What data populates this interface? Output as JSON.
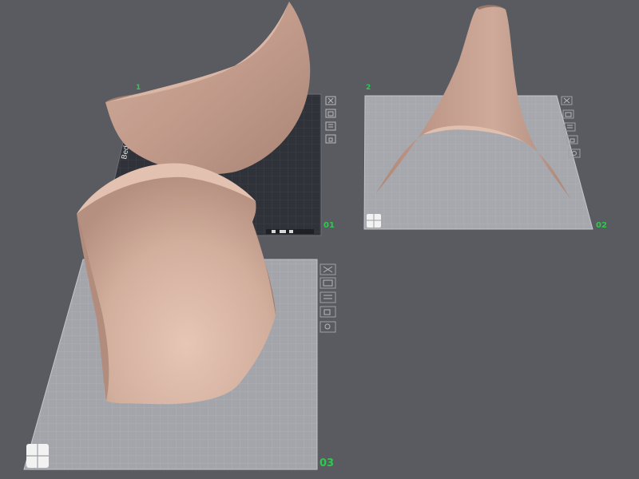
{
  "plates": [
    {
      "number": "01",
      "marker": "1",
      "vertical_label": "Bed Plate",
      "theme": "dark"
    },
    {
      "number": "02",
      "marker": "2",
      "theme": "light"
    },
    {
      "number": "03",
      "marker": "3",
      "theme": "light"
    }
  ],
  "plate_tools": [
    "close-icon",
    "camera-icon",
    "settings-icon",
    "lock-icon",
    "eye-icon"
  ],
  "colors": {
    "background": "#595b61",
    "model": "#c9a393",
    "plate_light": "#a3a5ab",
    "plate_dark": "#2e3036",
    "plate_number": "#2ec94d"
  }
}
